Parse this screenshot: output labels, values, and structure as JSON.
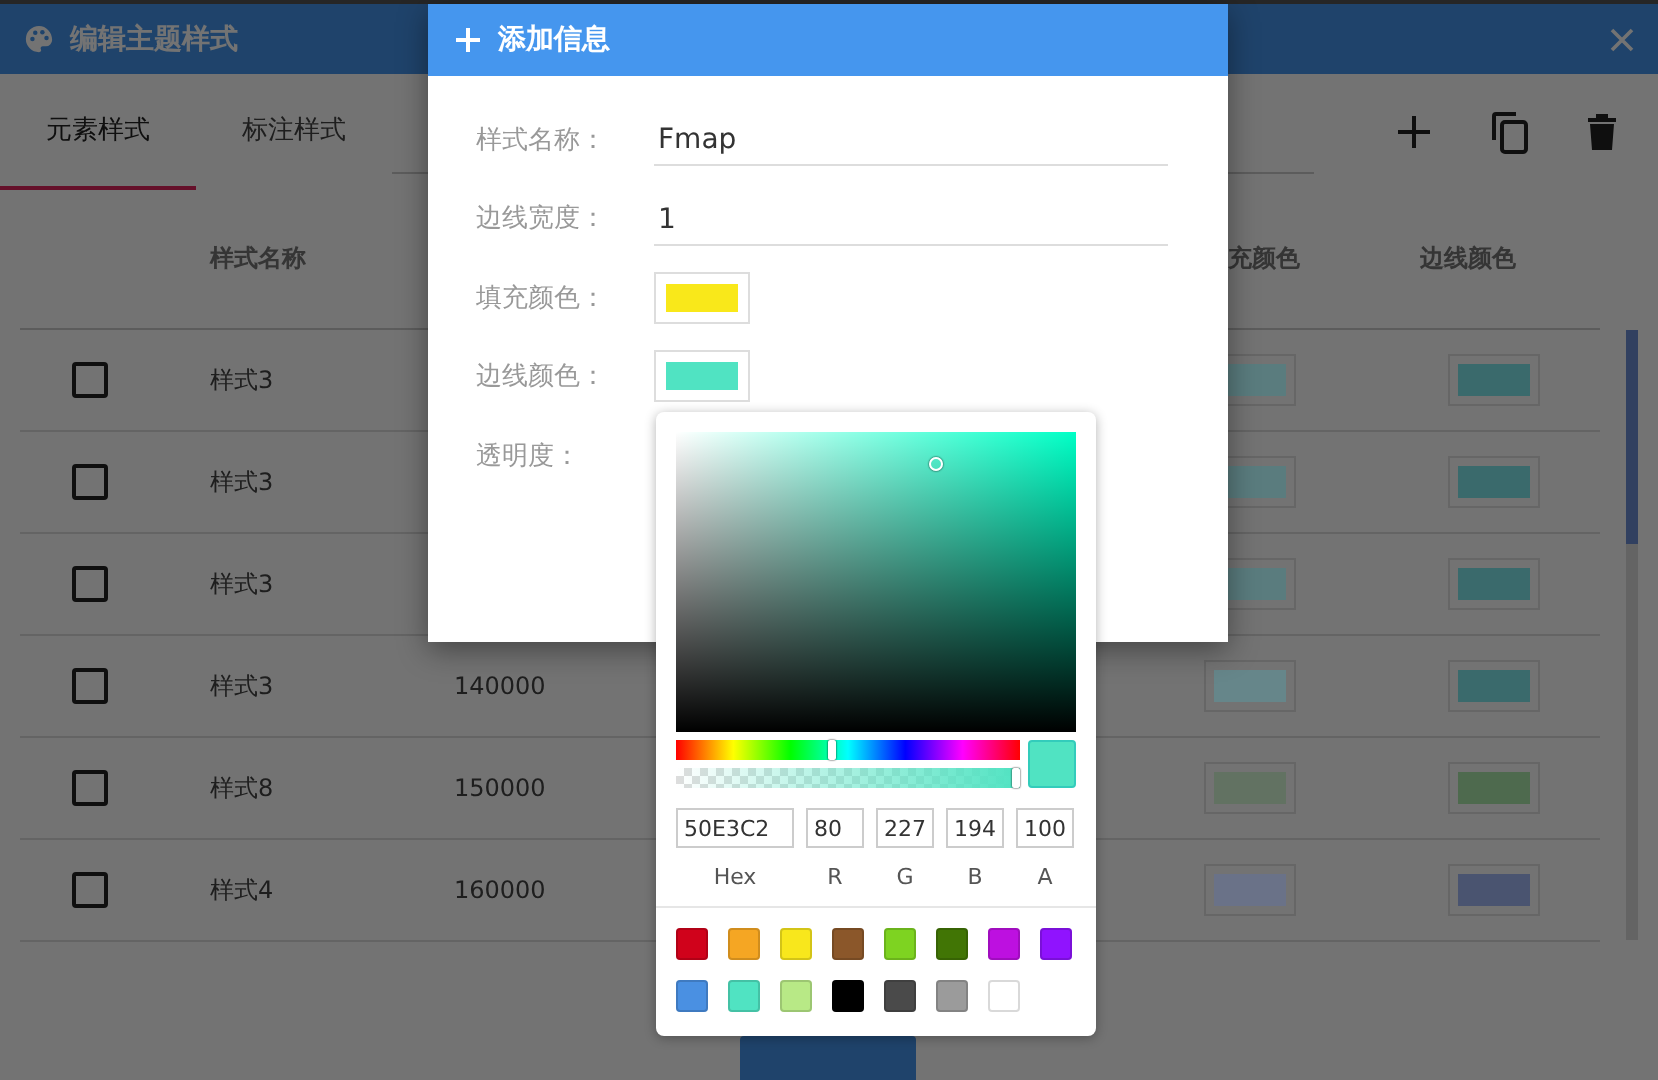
{
  "window": {
    "title": "编辑主题样式"
  },
  "tabs": [
    {
      "label": "元素样式",
      "selected": true
    },
    {
      "label": "标注样式",
      "selected": false
    }
  ],
  "table": {
    "name_header": "样式名称",
    "fill_header": "充颜色",
    "border_header": "边线颜色",
    "rows": [
      {
        "checked": false,
        "name": "样式3",
        "fill": {
          "color": "#5a7c7e"
        },
        "border": {
          "color": "#3a6a6c"
        }
      },
      {
        "checked": false,
        "name": "样式3",
        "fill": {
          "color": "#5a7c7e"
        },
        "border": {
          "color": "#3a6a6c"
        }
      },
      {
        "checked": false,
        "name": "样式3",
        "fill": {
          "color": "#5a7c7e"
        },
        "border": {
          "color": "#3a6a6c"
        }
      },
      {
        "checked": false,
        "name": "样式3",
        "value": "140000",
        "fill": {
          "color": "#66868a"
        },
        "border": {
          "color": "#3a6a6c"
        }
      },
      {
        "checked": false,
        "name": "样式8",
        "value": "150000",
        "fill": {
          "color": "#627262"
        },
        "border": {
          "color": "#4e6a4e"
        }
      },
      {
        "checked": false,
        "name": "样式4",
        "value": "160000",
        "fill": {
          "color": "#6a7288"
        },
        "border": {
          "color": "#4a5470"
        }
      }
    ]
  },
  "dialog": {
    "title": "添加信息",
    "fields": [
      {
        "kind": "text",
        "label": "样式名称：",
        "value": "Fmap"
      },
      {
        "kind": "text",
        "label": "边线宽度：",
        "value": "1"
      },
      {
        "kind": "color",
        "label": "填充颜色：",
        "color": "#f9e81a"
      },
      {
        "kind": "color",
        "label": "边线颜色：",
        "color": "#50e3c2"
      },
      {
        "kind": "opacity",
        "label": "透明度："
      }
    ]
  },
  "color_picker": {
    "hex": "50E3C2",
    "r": "80",
    "g": "227",
    "b": "194",
    "a": "100",
    "labels": [
      "Hex",
      "R",
      "G",
      "B",
      "A"
    ],
    "presets": [
      {
        "color": "#d0021b"
      },
      {
        "color": "#f5a623"
      },
      {
        "color": "#f8e71c"
      },
      {
        "color": "#8b572a"
      },
      {
        "color": "#7ed321"
      },
      {
        "color": "#417505"
      },
      {
        "color": "#bd10e0"
      },
      {
        "color": "#9013fe"
      },
      {
        "color": "#4a90e2"
      },
      {
        "color": "#50e3c2"
      },
      {
        "color": "#b8e986"
      },
      {
        "color": "#000000"
      },
      {
        "color": "#4a4a4a"
      },
      {
        "color": "#9b9b9b"
      },
      {
        "color": "#ffffff"
      }
    ]
  }
}
